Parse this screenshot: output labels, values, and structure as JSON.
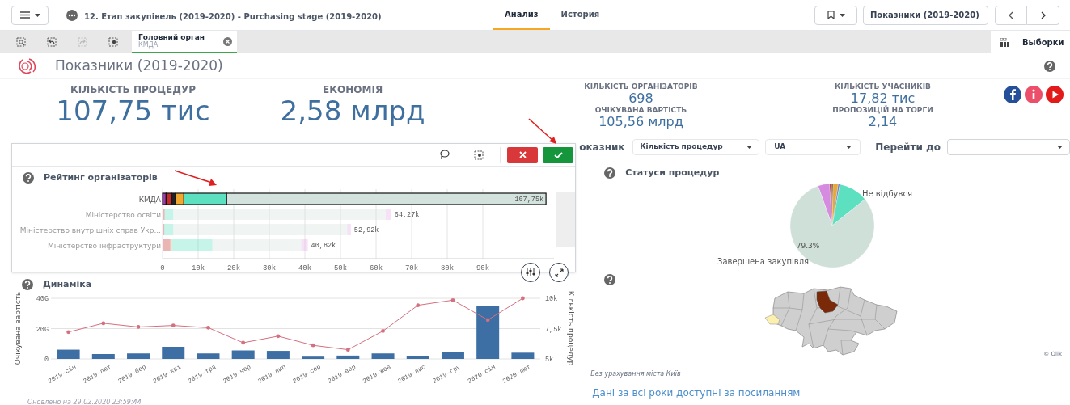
{
  "toolbar": {
    "title": "12. Етап закупівель (2019-2020) - Purchasing stage (2019-2020)",
    "tabs": [
      {
        "label": "Анализ",
        "selected": true
      },
      {
        "label": "История",
        "selected": false
      }
    ],
    "sheet_selector": "Показники (2019-2020)"
  },
  "selections_bar": {
    "chips": [
      {
        "field": "Головний орган",
        "value": "КМДА"
      }
    ],
    "selections_label": "Выборки"
  },
  "sheet_title": "Показники (2019-2020)",
  "main_kpis": [
    {
      "label": "КІЛЬКІСТЬ ПРОЦЕДУР",
      "value": "107,75 тис"
    },
    {
      "label": "ЕКОНОМІЯ",
      "value": "2,58 млрд"
    }
  ],
  "side_kpis": [
    [
      {
        "label": "КІЛЬКІСТЬ ОРГАНІЗАТОРІВ",
        "value": "698"
      },
      {
        "label": "ОЧІКУВАНА ВАРТІСТЬ",
        "value": "105,56 млрд"
      }
    ],
    [
      {
        "label": "КІЛЬКІСТЬ УЧАСНИКІВ",
        "value": "17,82 тис"
      },
      {
        "label": "ПРОПОЗИЦІЙ НА ТОРГИ",
        "value": "2,14"
      }
    ]
  ],
  "filters": {
    "indicator_label": "оказник",
    "indicator": "Кількість процедур",
    "region": "UA",
    "goto_label": "Перейти до"
  },
  "rating_chart": {
    "title": "Рейтинг організаторів",
    "selected_rows": [
      true,
      false,
      false,
      false
    ],
    "chart_data": {
      "type": "bar",
      "orientation": "horizontal",
      "stacked": true,
      "grid": true,
      "categories": [
        "КМДА",
        "Міністерство освіти",
        "Міністерство внутрішніх справ Укр...",
        "Міністерство інфраструктури"
      ],
      "series": [
        {
          "color": "#a13bb3",
          "values": [
            1000,
            0,
            0,
            0
          ]
        },
        {
          "color": "#c92a2a",
          "values": [
            1500,
            600,
            500,
            2200
          ]
        },
        {
          "color": "#222222",
          "values": [
            1200,
            0,
            0,
            0
          ]
        },
        {
          "color": "#f0a830",
          "values": [
            2300,
            0,
            0,
            400
          ]
        },
        {
          "color": "#5de0c0",
          "values": [
            12000,
            2400,
            2500,
            11400
          ]
        },
        {
          "color": "#d3e2dc",
          "values": [
            89750,
            59670,
            48920,
            25020
          ]
        },
        {
          "color": "#e8a8e8",
          "values": [
            0,
            1600,
            1000,
            1800
          ]
        }
      ],
      "value_labels": [
        "107,75k",
        "64,27k",
        "52,92k",
        "40,82k"
      ],
      "xlim": [
        0,
        110000
      ],
      "xticks": [
        {
          "value": 0,
          "label": "0"
        },
        {
          "value": 10000,
          "label": "10k"
        },
        {
          "value": 20000,
          "label": "20k"
        },
        {
          "value": 30000,
          "label": "30k"
        },
        {
          "value": 40000,
          "label": "40k"
        },
        {
          "value": 50000,
          "label": "50k"
        },
        {
          "value": 60000,
          "label": "60k"
        },
        {
          "value": 70000,
          "label": "70k"
        },
        {
          "value": 80000,
          "label": "80k"
        },
        {
          "value": 90000,
          "label": "90k"
        }
      ]
    }
  },
  "dynamics": {
    "title": "Динаміка",
    "updated": "Оновлено на 29.02.2020 23:59:44",
    "bar_chart": {
      "chart_data": {
        "type": "bar",
        "ylabel": "Очікувана вартість",
        "categories": [
          "2019-січ",
          "2019-лют",
          "2019-бер",
          "2019-кві",
          "2019-тра",
          "2019-чер",
          "2019-лип",
          "2019-сер",
          "2019-вер",
          "2019-жов",
          "2019-лис",
          "2019-гру",
          "2020-січ",
          "2020-лют"
        ],
        "ylim": [
          0,
          40
        ],
        "yticks": [
          {
            "value": 0,
            "label": "0"
          },
          {
            "value": 20,
            "label": "20G"
          },
          {
            "value": 40,
            "label": "40G"
          }
        ],
        "series": [
          {
            "color": "#3d6fa5",
            "values": [
              6.1,
              3.2,
              3.6,
              8,
              3.6,
              5.6,
              5.3,
              1.5,
              2.2,
              3.6,
              1.9,
              4.4,
              34.9,
              4.1
            ]
          }
        ]
      }
    },
    "line_chart": {
      "chart_data": {
        "type": "line",
        "ylabel": "Кількість процедур",
        "categories": [
          null,
          null,
          null,
          null,
          null,
          null,
          null,
          null,
          null,
          null,
          null,
          null,
          null,
          null
        ],
        "ylim": [
          5000,
          10000
        ],
        "yticks": [
          {
            "value": 5000,
            "label": "5k"
          },
          {
            "value": 7500,
            "label": "7,5k"
          },
          {
            "value": 10000,
            "label": "10k"
          }
        ],
        "series": [
          {
            "color": "#d4707f",
            "values": [
              7212,
              7939,
              7636,
              7758,
              7576,
              6333,
              6879,
              6121,
              5758,
              7303,
              9424,
              9848,
              8212,
              10000
            ]
          }
        ]
      }
    }
  },
  "statuses": {
    "title": "Статуси процедур",
    "labels": [
      {
        "kind": "slice",
        "text": "Не відбувся"
      },
      {
        "kind": "percent",
        "text": "79.3%"
      },
      {
        "kind": "slice",
        "text": "Завершена закупівля"
      }
    ]
  },
  "map": {
    "credit": "© Qlik",
    "note": "Без урахування міста Київ",
    "link": "Дані за всі роки доступні за посиланням"
  }
}
